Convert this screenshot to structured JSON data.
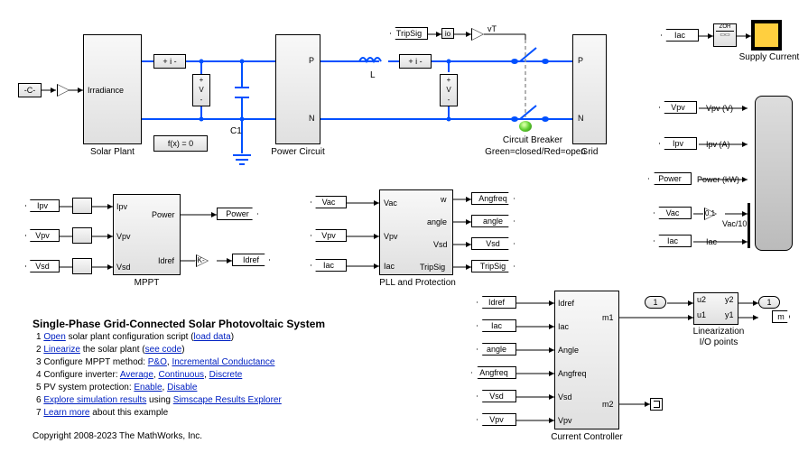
{
  "title": "Single-Phase Grid-Connected Solar Photovoltaic System",
  "copyright": "Copyright 2008-2023 The MathWorks, Inc.",
  "notes": [
    {
      "n": "1",
      "pre": "",
      "links": [
        "Open"
      ],
      "mid": " solar plant configuration script (",
      "post": ")",
      "link2": "load data"
    },
    {
      "n": "2",
      "pre": "",
      "links": [
        "Linearize"
      ],
      "mid": " the solar plant (",
      "post": ")",
      "link2": "see code"
    },
    {
      "n": "3",
      "pre": "Configure MPPT method: ",
      "links": [
        "P&O",
        "Incremental Conductance"
      ]
    },
    {
      "n": "4",
      "pre": "Configure inverter: ",
      "links": [
        "Average",
        "Continuous",
        "Discrete"
      ]
    },
    {
      "n": "5",
      "pre": "PV system protection: ",
      "links": [
        "Enable",
        "Disable"
      ]
    },
    {
      "n": "6",
      "pre": "",
      "links": [
        "Explore simulation results"
      ],
      "mid": " using ",
      "post": "",
      "link2": "Simscape Results Explorer"
    },
    {
      "n": "7",
      "pre": "",
      "links": [
        "Learn more"
      ],
      "mid": " about this example"
    }
  ],
  "blocks": {
    "const": "-C-",
    "irradiance": "Irradiance",
    "solarPlant": "Solar Plant",
    "fx": "f(x) = 0",
    "C1": "C1",
    "powerCircuit": "Power Circuit",
    "L": "L",
    "circuitBreaker": "Circuit Breaker",
    "breakerNote": "Green=closed/Red=open",
    "grid": "Grid",
    "scope": "Supply Current",
    "mppt": "MPPT",
    "pll": "PLL and Protection",
    "cc": "Current Controller",
    "lin": "Linearization",
    "linIO": "I/O points",
    "zoh": "ZOH",
    "gain": "-K-",
    "gainVac": "0.1",
    "vacDiv": "Vac/10",
    "one": "1"
  },
  "ports": {
    "plusI": "+ i -",
    "plusV": "+\nV\n-",
    "P": "P",
    "N": "N",
    "vT": "vT",
    "io": "io",
    "Ipv": "Ipv",
    "Vpv": "Vpv",
    "Vsd": "Vsd",
    "Power": "Power",
    "Idref": "Idref",
    "Vac": "Vac",
    "Iac": "Iac",
    "w": "w",
    "angle": "angle",
    "TripSig": "TripSig",
    "Angfreq": "Angfreq",
    "m1": "m1",
    "m2": "m2",
    "u2": "u2",
    "u1": "u1",
    "y2": "y2",
    "y1": "y1",
    "m": "m",
    "PpvV": "Vpv (V)",
    "IpvA": "Ipv (A)",
    "PowerKW": "Power (kW)",
    "Angle": "Angle"
  },
  "tags": {
    "Ipv": "Ipv",
    "Vpv": "Vpv",
    "Vsd": "Vsd",
    "Power": "Power",
    "Idref": "Idref",
    "Vac": "Vac",
    "Iac": "Iac",
    "Angfreq": "Angfreq",
    "angle": "angle",
    "TripSig": "TripSig"
  }
}
